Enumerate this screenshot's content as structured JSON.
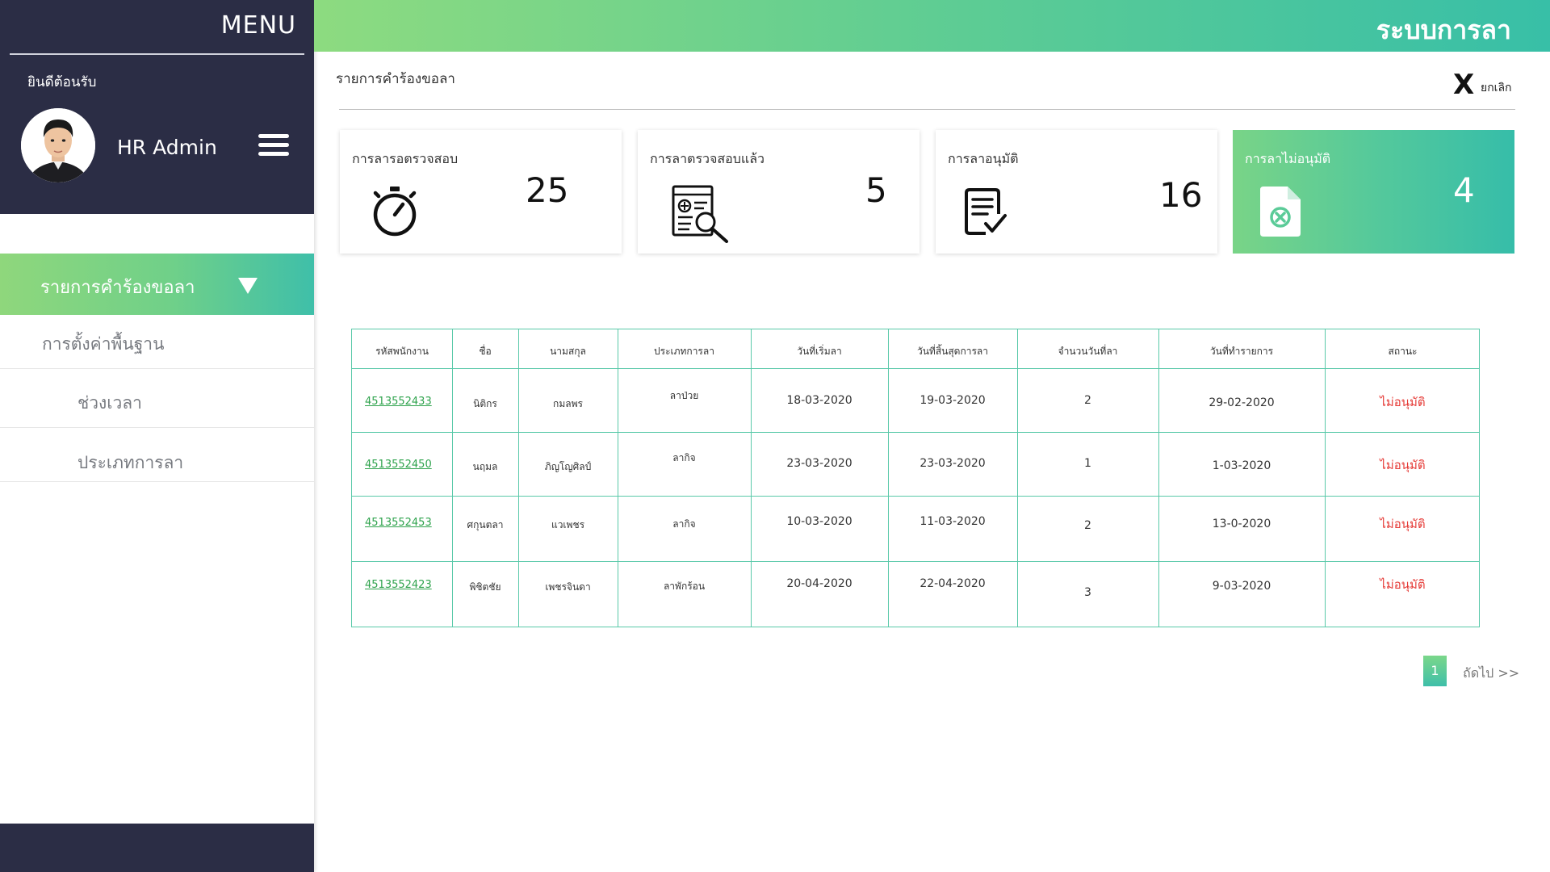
{
  "sidebar": {
    "menu_title": "MENU",
    "welcome": "ยินดีต้อนรับ",
    "user_name": "HR Admin",
    "nav_active": "รายการคำร้องขอลา",
    "nav_settings": "การตั้งค่าพื้นฐาน",
    "nav_period": "ช่วงเวลา",
    "nav_leave_type": "ประเภทการลา"
  },
  "header": {
    "system_title": "ระบบการลา",
    "page_title": "รายการคำร้องขอลา",
    "cancel_label": "ยกเลิก",
    "cancel_icon": "X"
  },
  "cards": [
    {
      "label": "การลารอตรวจสอบ",
      "value": "25",
      "icon": "stopwatch-icon"
    },
    {
      "label": "การลาตรวจสอบแล้ว",
      "value": "5",
      "icon": "document-search-icon"
    },
    {
      "label": "การลาอนุมัติ",
      "value": "16",
      "icon": "document-check-icon"
    },
    {
      "label": "การลาไม่อนุมัติ",
      "value": "4",
      "icon": "file-reject-icon"
    }
  ],
  "table": {
    "headers": [
      "รหัสพนักงาน",
      "ชื่อ",
      "นามสกุล",
      "ประเภทการลา",
      "วันที่เริ่มลา",
      "วันที่สิ้นสุดการลา",
      "จำนวนวันที่ลา",
      "วันที่ทำรายการ",
      "สถานะ"
    ],
    "rows": [
      {
        "id": "4513552433",
        "first": "นิติกร",
        "last": "กมลพร",
        "type": "ลาป่วย",
        "start": "18-03-2020",
        "end": "19-03-2020",
        "days": "2",
        "created": "29-02-2020",
        "status": "ไม่อนุมัติ"
      },
      {
        "id": "4513552450",
        "first": "นฤมล",
        "last": "ภิญโญศิลป์",
        "type": "ลากิจ",
        "start": "23-03-2020",
        "end": "23-03-2020",
        "days": "1",
        "created": "1-03-2020",
        "status": "ไม่อนุมัติ"
      },
      {
        "id": "4513552453",
        "first": "ศกุนตลา",
        "last": "แวเพชร",
        "type": "ลากิจ",
        "start": "10-03-2020",
        "end": "11-03-2020",
        "days": "2",
        "created": "13-0-2020",
        "status": "ไม่อนุมัติ"
      },
      {
        "id": "4513552423",
        "first": "พิชิตชัย",
        "last": "เพชรจินดา",
        "type": "ลาพักร้อน",
        "start": "20-04-2020",
        "end": "22-04-2020",
        "days": "3",
        "created": "9-03-2020",
        "status": "ไม่อนุมัติ"
      }
    ]
  },
  "pagination": {
    "current": "1",
    "next": "ถัดไป >>"
  },
  "colors": {
    "sidebar_dark": "#2b2d45",
    "accent_green": "#6fd089",
    "accent_teal": "#3fbfa9",
    "status_red": "#e53935",
    "link_green": "#2fa34d"
  }
}
